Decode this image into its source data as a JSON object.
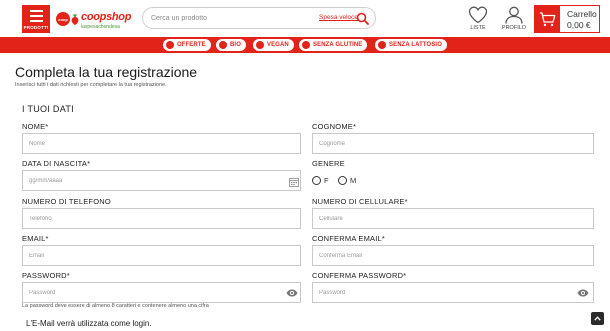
{
  "header": {
    "menu_label": "PRODOTTI",
    "logo": {
      "badge_text": "coop",
      "brand": "coopshop",
      "tagline": "laspesachendesa"
    },
    "search": {
      "placeholder": "Cerca un prodotto",
      "fast_label": "Spesa veloce"
    },
    "liste_label": "LISTE",
    "profilo_label": "PROFILO",
    "cart": {
      "label": "Carrello",
      "amount": "0,00 €"
    }
  },
  "filters": [
    {
      "label": "OFFERTE",
      "icon": "offer-tag-icon"
    },
    {
      "label": "BIO",
      "icon": "bio-leaf-icon"
    },
    {
      "label": "VEGAN",
      "icon": "vegan-leaf-icon"
    },
    {
      "label": "SENZA GLUTINE",
      "icon": "gluten-free-icon"
    },
    {
      "label": "SENZA LATTOSIO",
      "icon": "lactose-free-icon"
    }
  ],
  "page": {
    "title": "Completa la tua registrazione",
    "subtitle": "Inserisci tutti i dati richiesti per completare la tua registrazione."
  },
  "form": {
    "section_title": "I TUOI DATI",
    "nome": {
      "label": "NOME*",
      "placeholder": "Nome",
      "value": ""
    },
    "cognome": {
      "label": "COGNOME*",
      "placeholder": "Cognome",
      "value": ""
    },
    "data_nascita": {
      "label": "DATA DI NASCITA*",
      "placeholder": "gg/mm/aaaa",
      "value": ""
    },
    "genere": {
      "label": "GENERE",
      "options": [
        "F",
        "M"
      ]
    },
    "telefono": {
      "label": "NUMERO DI TELEFONO",
      "placeholder": "Telefono",
      "value": ""
    },
    "cellulare": {
      "label": "NUMERO DI CELLULARE*",
      "placeholder": "Cellulare",
      "value": ""
    },
    "email": {
      "label": "EMAIL*",
      "placeholder": "Email",
      "value": ""
    },
    "conferma_email": {
      "label": "CONFERMA EMAIL*",
      "placeholder": "Conferma Email",
      "value": ""
    },
    "password": {
      "label": "PASSWORD*",
      "placeholder": "Password",
      "value": ""
    },
    "conferma_password": {
      "label": "CONFERMA PASSWORD*",
      "placeholder": "Password",
      "value": ""
    },
    "password_hint": "La password deve essere di almeno 8 caratteri e contenere almeno una cifra",
    "login_note": "L'E-Mail verrà utilizzata come login."
  },
  "colors": {
    "brand_red": "#e2231a",
    "brand_green": "#4a9a32"
  }
}
